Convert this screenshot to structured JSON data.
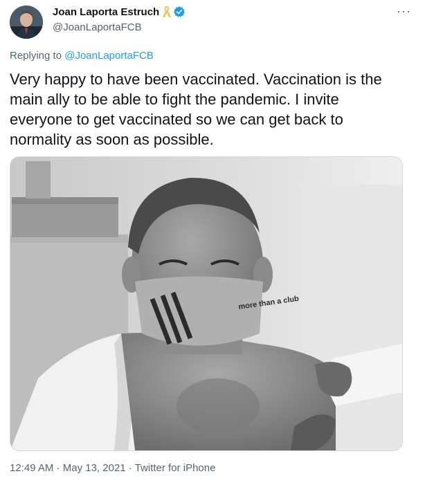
{
  "author": {
    "display_name": "Joan Laporta Estruch",
    "handle": "@JoanLaportaFCB",
    "verified": true,
    "ribbon_color": "#f2c14e",
    "verified_color": "#1d9bf0"
  },
  "menu": {
    "more_icon": "more-horizontal-icon",
    "more_label": "···"
  },
  "reply": {
    "prefix": "Replying to",
    "mention": "@JoanLaportaFCB"
  },
  "text": "Very happy to have been vaccinated. Vaccination is the main ally to be able to fight the pandemic. I invite everyone to get vaccinated so we can get back to normality as soon as possible.",
  "media": {
    "mask_print": "more than a club"
  },
  "meta": {
    "time": "12:49 AM",
    "separator": "·",
    "date": "May 13, 2021",
    "source": "Twitter for iPhone"
  },
  "colors": {
    "link": "#1d9bf0",
    "secondary_text": "#536471",
    "primary_text": "#0f1419"
  }
}
